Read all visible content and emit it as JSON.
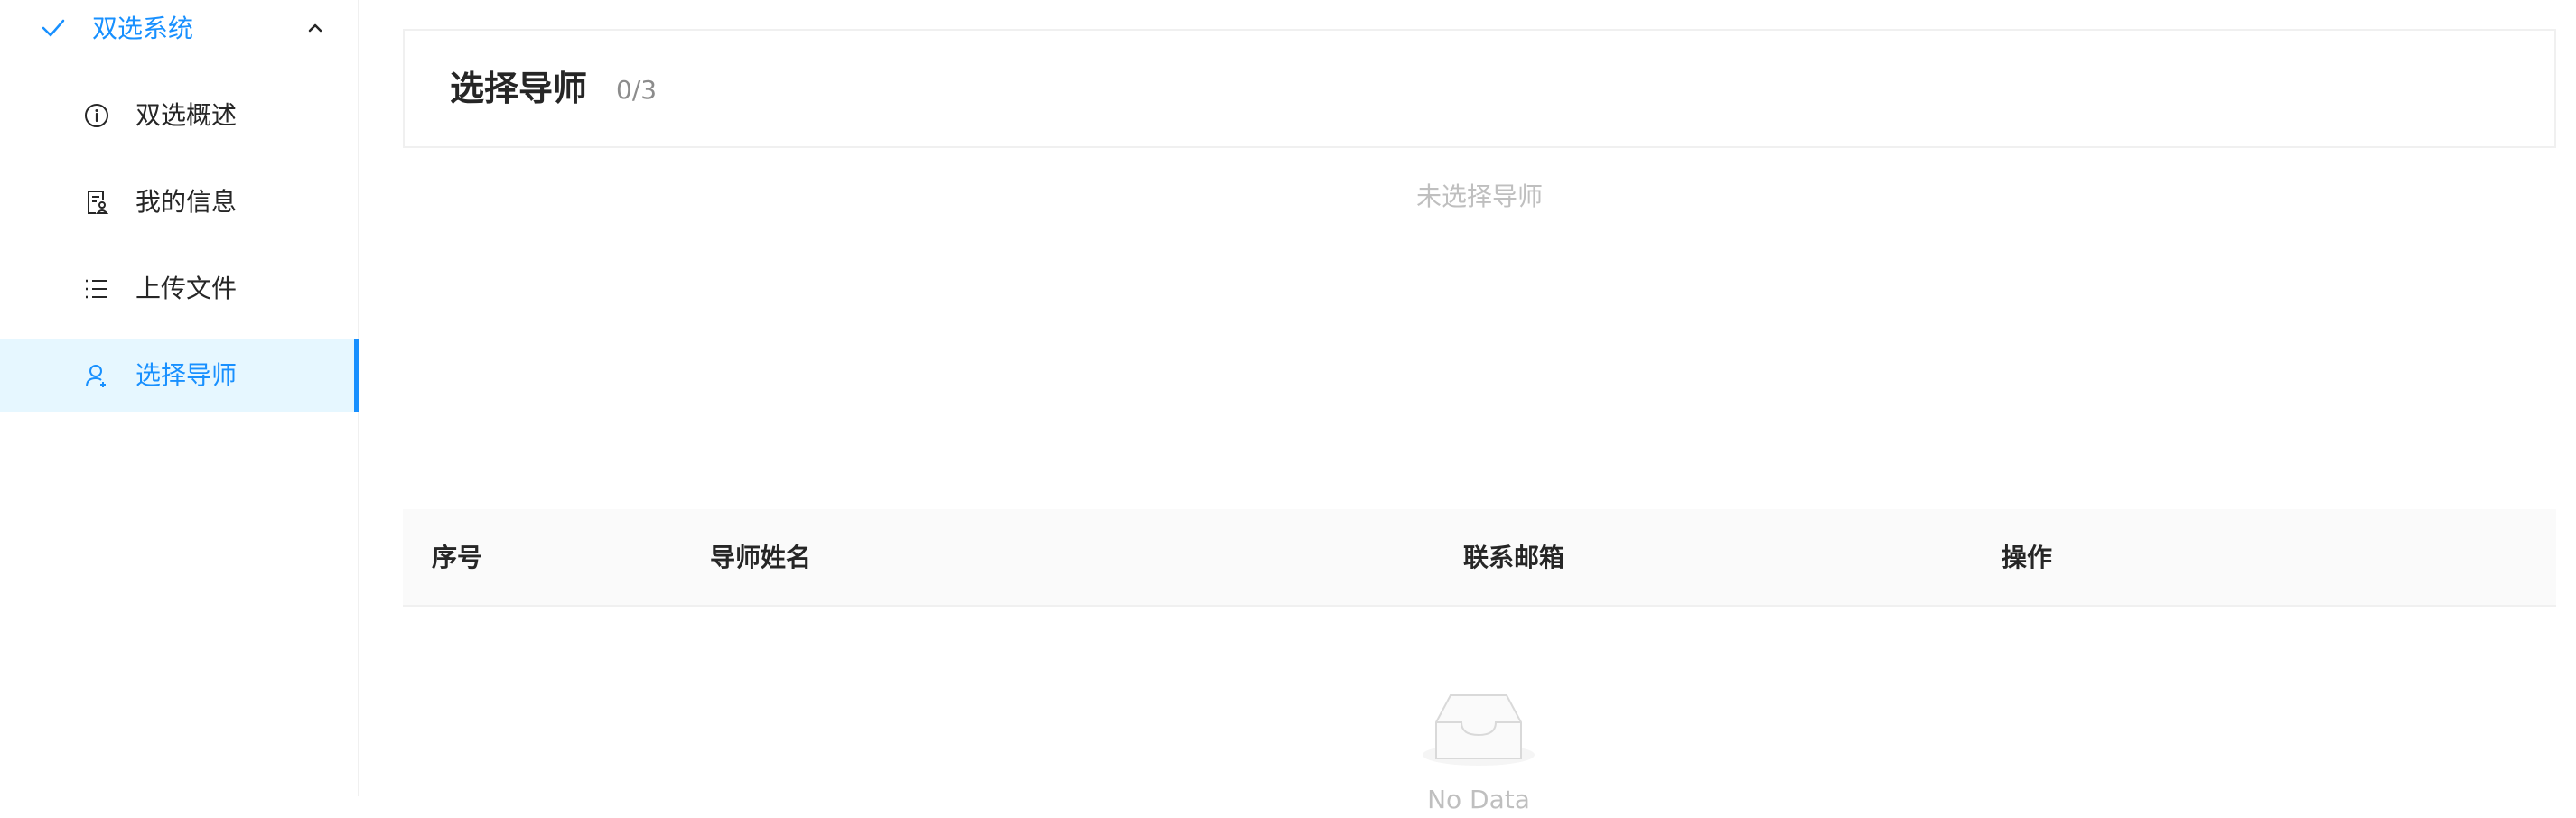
{
  "sidebar": {
    "submenu": {
      "label": "双选系统",
      "icon": "check-icon",
      "expand_icon": "chevron-up-icon"
    },
    "items": [
      {
        "label": "双选概述",
        "icon": "info-circle-icon"
      },
      {
        "label": "我的信息",
        "icon": "profile-icon"
      },
      {
        "label": "上传文件",
        "icon": "list-icon"
      },
      {
        "label": "选择导师",
        "icon": "user-icon",
        "active": true
      }
    ]
  },
  "main": {
    "panel": {
      "title": "选择导师",
      "count": "0/3"
    },
    "empty_text": "未选择导师",
    "table": {
      "columns": [
        "序号",
        "导师姓名",
        "联系邮箱",
        "操作"
      ],
      "rows": [],
      "empty_text": "No Data"
    }
  },
  "colors": {
    "accent": "#1890ff",
    "active_bg": "#e6f7ff",
    "muted": "#bfbfbf",
    "header_bg": "#fafafa"
  }
}
